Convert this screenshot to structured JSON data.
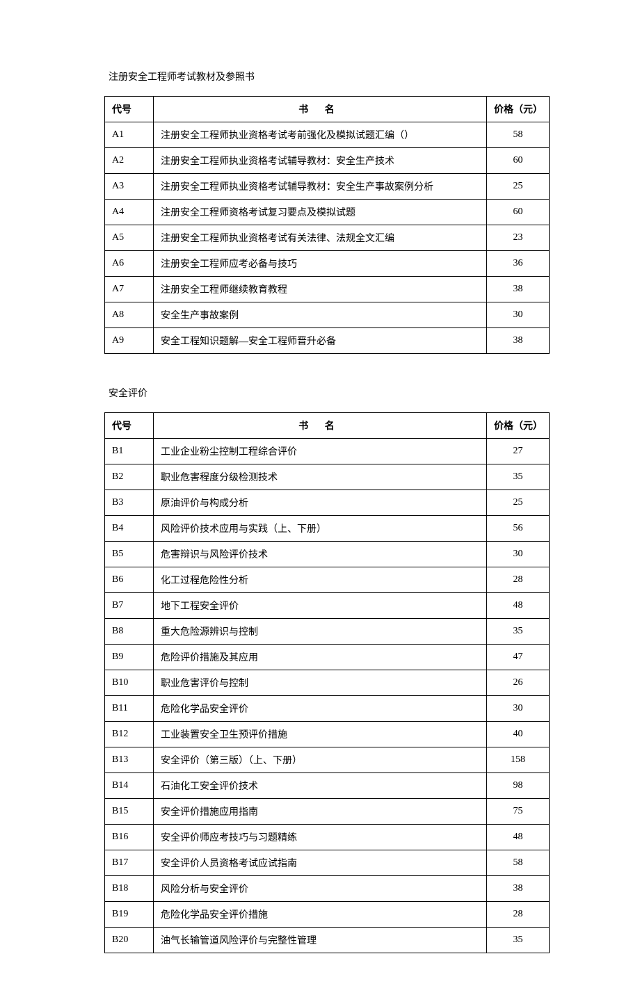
{
  "sections": [
    {
      "title": "注册安全工程师考试教材及参照书",
      "headers": {
        "code": "代号",
        "name": "书  名",
        "price": "价格（元）"
      },
      "rows": [
        {
          "code": "A1",
          "name": "注册安全工程师执业资格考试考前强化及模拟试题汇编（）",
          "price": "58"
        },
        {
          "code": "A2",
          "name": "注册安全工程师执业资格考试辅导教材：安全生产技术",
          "price": "60"
        },
        {
          "code": "A3",
          "name": "注册安全工程师执业资格考试辅导教材：安全生产事故案例分析",
          "price": "25"
        },
        {
          "code": "A4",
          "name": "注册安全工程师资格考试复习要点及模拟试题",
          "price": "60"
        },
        {
          "code": "A5",
          "name": "注册安全工程师执业资格考试有关法律、法规全文汇编",
          "price": "23"
        },
        {
          "code": "A6",
          "name": "注册安全工程师应考必备与技巧",
          "price": "36"
        },
        {
          "code": "A7",
          "name": "注册安全工程师继续教育教程",
          "price": "38"
        },
        {
          "code": "A8",
          "name": "安全生产事故案例",
          "price": "30"
        },
        {
          "code": "A9",
          "name": "安全工程知识题解—安全工程师晋升必备",
          "price": "38"
        }
      ]
    },
    {
      "title": "安全评价",
      "headers": {
        "code": "代号",
        "name": "书  名",
        "price": "价格（元）"
      },
      "rows": [
        {
          "code": "B1",
          "name": "工业企业粉尘控制工程综合评价",
          "price": "27"
        },
        {
          "code": "B2",
          "name": "职业危害程度分级检测技术",
          "price": "35"
        },
        {
          "code": "B3",
          "name": "原油评价与构成分析",
          "price": "25"
        },
        {
          "code": "B4",
          "name": "风险评价技术应用与实践（上、下册）",
          "price": "56"
        },
        {
          "code": "B5",
          "name": "危害辩识与风险评价技术",
          "price": "30"
        },
        {
          "code": "B6",
          "name": "化工过程危险性分析",
          "price": "28"
        },
        {
          "code": "B7",
          "name": "地下工程安全评价",
          "price": "48"
        },
        {
          "code": "B8",
          "name": "重大危险源辨识与控制",
          "price": "35"
        },
        {
          "code": "B9",
          "name": "危险评价措施及其应用",
          "price": "47"
        },
        {
          "code": "B10",
          "name": "职业危害评价与控制",
          "price": "26"
        },
        {
          "code": "B11",
          "name": "危险化学品安全评价",
          "price": "30"
        },
        {
          "code": "B12",
          "name": "工业装置安全卫生预评价措施",
          "price": "40"
        },
        {
          "code": "B13",
          "name": "安全评价（第三版）（上、下册）",
          "price": "158"
        },
        {
          "code": "B14",
          "name": "石油化工安全评价技术",
          "price": "98"
        },
        {
          "code": "B15",
          "name": "安全评价措施应用指南",
          "price": "75"
        },
        {
          "code": "B16",
          "name": "安全评价师应考技巧与习题精练",
          "price": "48"
        },
        {
          "code": "B17",
          "name": "安全评价人员资格考试应试指南",
          "price": "58"
        },
        {
          "code": "B18",
          "name": "风险分析与安全评价",
          "price": "38"
        },
        {
          "code": "B19",
          "name": "危险化学品安全评价措施",
          "price": "28"
        },
        {
          "code": "B20",
          "name": "油气长输管道风险评价与完整性管理",
          "price": "35"
        }
      ]
    }
  ]
}
